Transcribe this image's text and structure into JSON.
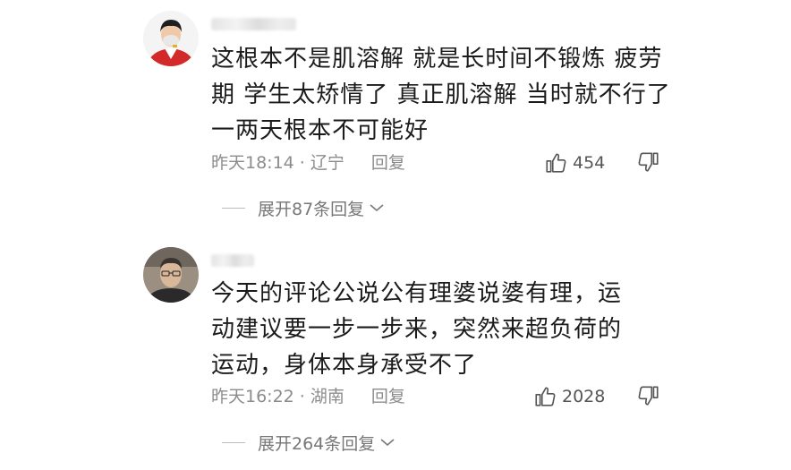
{
  "comments": [
    {
      "text": "这根本不是肌溶解  就是长时间不锻炼  疲劳期  学生太矫情了  真正肌溶解 当时就不行了  一两天根本不可能好",
      "time": "昨天18:14",
      "location": "辽宁",
      "reply_label": "回复",
      "likes": "454",
      "expand_label": "展开87条回复"
    },
    {
      "text": "今天的评论公说公有理婆说婆有理，运动建议要一步一步来，突然来超负荷的运动，身体本身承受不了",
      "time": "昨天16:22",
      "location": "湖南",
      "reply_label": "回复",
      "likes": "2028",
      "expand_label": "展开264条回复"
    }
  ],
  "separator": " · ",
  "icons": {
    "like": "thumbs-up-icon",
    "dislike": "thumbs-down-icon",
    "expand": "chevron-down-icon"
  },
  "colors": {
    "text": "#1b1b1b",
    "meta": "#8c8c8c",
    "avatar1_bg": "#d22a2a"
  }
}
